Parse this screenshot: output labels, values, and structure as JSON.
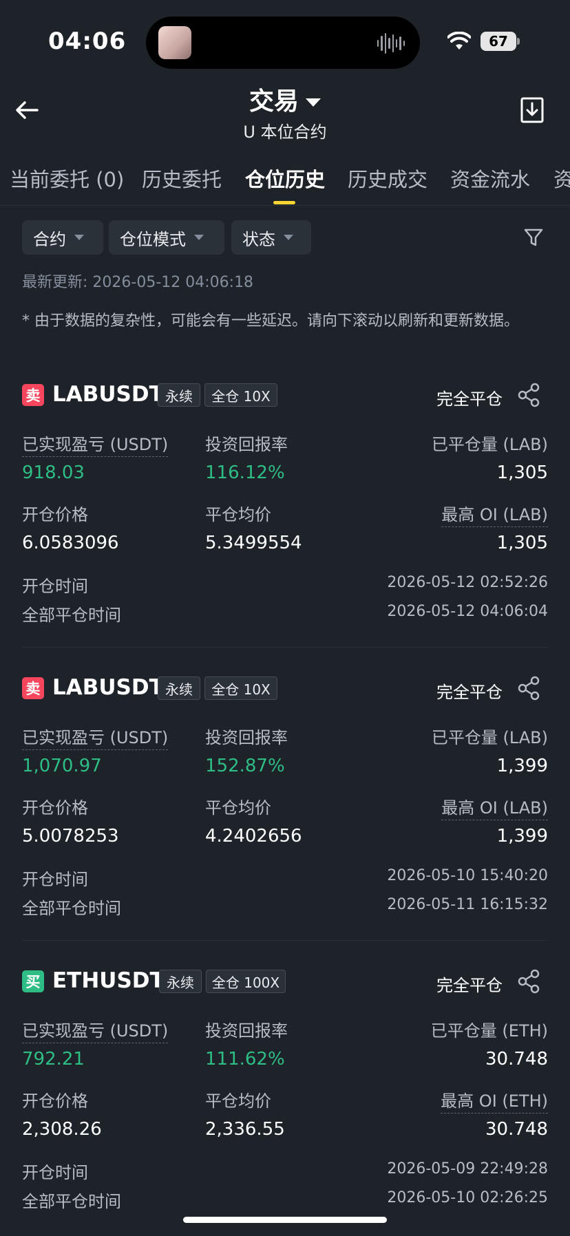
{
  "status_bar": {
    "time": "04:06",
    "battery": "67"
  },
  "header": {
    "title": "交易",
    "subtitle": "U 本位合约"
  },
  "tabs": [
    "当前委托 (0)",
    "历史委托",
    "仓位历史",
    "历史成交",
    "资金流水",
    "资"
  ],
  "active_tab": "仓位历史",
  "filters": [
    "合约",
    "仓位模式",
    "状态"
  ],
  "updated": "最新更新: 2026-05-12 04:06:18",
  "note": "* 由于数据的复杂性，可能会有一些延迟。请向下滚动以刷新和更新数据。",
  "labels": {
    "pnl": "已实现盈亏 (USDT)",
    "roi": "投资回报率",
    "open_price": "开仓价格",
    "close_avg": "平仓均价",
    "open_time": "开仓时间",
    "close_time": "全部平仓时间"
  },
  "positions": [
    {
      "side": "卖",
      "side_type": "sell",
      "symbol": "LABUSDT",
      "perp": "永续",
      "margin": "全仓 10X",
      "status": "完全平仓",
      "closed_qty_label": "已平仓量 (LAB)",
      "max_oi_label": "最高 OI (LAB)",
      "pnl": "918.03",
      "roi": "116.12%",
      "closed_qty": "1,305",
      "open_price": "6.0583096",
      "close_avg": "5.3499554",
      "max_oi": "1,305",
      "open_time": "2026-05-12 02:52:26",
      "close_time": "2026-05-12 04:06:04"
    },
    {
      "side": "卖",
      "side_type": "sell",
      "symbol": "LABUSDT",
      "perp": "永续",
      "margin": "全仓 10X",
      "status": "完全平仓",
      "closed_qty_label": "已平仓量 (LAB)",
      "max_oi_label": "最高 OI (LAB)",
      "pnl": "1,070.97",
      "roi": "152.87%",
      "closed_qty": "1,399",
      "open_price": "5.0078253",
      "close_avg": "4.2402656",
      "max_oi": "1,399",
      "open_time": "2026-05-10 15:40:20",
      "close_time": "2026-05-11 16:15:32"
    },
    {
      "side": "买",
      "side_type": "buy",
      "symbol": "ETHUSDT",
      "perp": "永续",
      "margin": "全仓 100X",
      "status": "完全平仓",
      "closed_qty_label": "已平仓量 (ETH)",
      "max_oi_label": "最高 OI (ETH)",
      "pnl": "792.21",
      "roi": "111.62%",
      "closed_qty": "30.748",
      "open_price": "2,308.26",
      "close_avg": "2,336.55",
      "max_oi": "30.748",
      "open_time": "2026-05-09 22:49:28",
      "close_time": "2026-05-10 02:26:25"
    }
  ],
  "colors": {
    "background": "#1e2329",
    "profit": "#2ebd85",
    "sell": "#f6465d",
    "buy": "#2ebd85",
    "accent": "#fcd535"
  }
}
